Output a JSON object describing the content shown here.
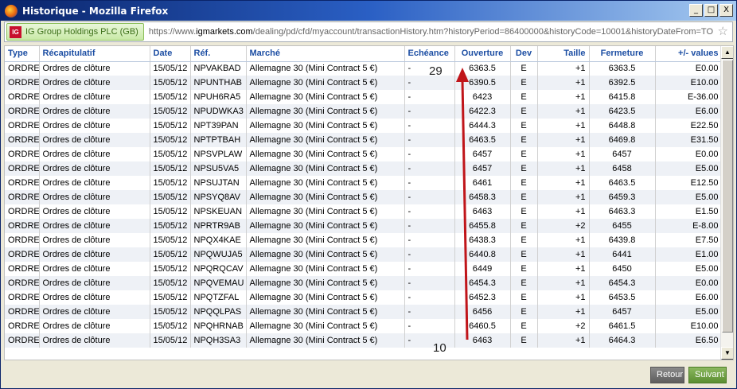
{
  "window": {
    "title": "Historique - Mozilla Firefox"
  },
  "controls": {
    "minimize": "_",
    "maximize": "□",
    "close": "X"
  },
  "urlbar": {
    "site_badge": "IG",
    "site_name": "IG Group Holdings PLC (GB)",
    "url_prefix": "https://www.",
    "url_domain": "igmarkets.com",
    "url_rest": "/dealing/pd/cfd/myaccount/transactionHistory.htm?historyPeriod=86400000&historyCode=10001&historyDateFrom=TO"
  },
  "table": {
    "headers": [
      "Type",
      "Récapitulatif",
      "Date",
      "Réf.",
      "Marché",
      "Echéance",
      "Ouverture",
      "Dev",
      "Taille",
      "Fermeture",
      "+/- values"
    ],
    "rows": [
      [
        "ORDRE",
        "Ordres de clôture",
        "15/05/12",
        "NPVAKBAD",
        "Allemagne 30 (Mini Contract 5 €)",
        "-",
        "6363.5",
        "E",
        "+1",
        "6363.5",
        "E0.00"
      ],
      [
        "ORDRE",
        "Ordres de clôture",
        "15/05/12",
        "NPUNTHAB",
        "Allemagne 30 (Mini Contract 5 €)",
        "-",
        "6390.5",
        "E",
        "+1",
        "6392.5",
        "E10.00"
      ],
      [
        "ORDRE",
        "Ordres de clôture",
        "15/05/12",
        "NPUH6RA5",
        "Allemagne 30 (Mini Contract 5 €)",
        "-",
        "6423",
        "E",
        "+1",
        "6415.8",
        "E-36.00"
      ],
      [
        "ORDRE",
        "Ordres de clôture",
        "15/05/12",
        "NPUDWKA3",
        "Allemagne 30 (Mini Contract 5 €)",
        "-",
        "6422.3",
        "E",
        "+1",
        "6423.5",
        "E6.00"
      ],
      [
        "ORDRE",
        "Ordres de clôture",
        "15/05/12",
        "NPT39PAN",
        "Allemagne 30 (Mini Contract 5 €)",
        "-",
        "6444.3",
        "E",
        "+1",
        "6448.8",
        "E22.50"
      ],
      [
        "ORDRE",
        "Ordres de clôture",
        "15/05/12",
        "NPTPTBAH",
        "Allemagne 30 (Mini Contract 5 €)",
        "-",
        "6463.5",
        "E",
        "+1",
        "6469.8",
        "E31.50"
      ],
      [
        "ORDRE",
        "Ordres de clôture",
        "15/05/12",
        "NPSVPLAW",
        "Allemagne 30 (Mini Contract 5 €)",
        "-",
        "6457",
        "E",
        "+1",
        "6457",
        "E0.00"
      ],
      [
        "ORDRE",
        "Ordres de clôture",
        "15/05/12",
        "NPSU5VA5",
        "Allemagne 30 (Mini Contract 5 €)",
        "-",
        "6457",
        "E",
        "+1",
        "6458",
        "E5.00"
      ],
      [
        "ORDRE",
        "Ordres de clôture",
        "15/05/12",
        "NPSUJTAN",
        "Allemagne 30 (Mini Contract 5 €)",
        "-",
        "6461",
        "E",
        "+1",
        "6463.5",
        "E12.50"
      ],
      [
        "ORDRE",
        "Ordres de clôture",
        "15/05/12",
        "NPSYQ8AV",
        "Allemagne 30 (Mini Contract 5 €)",
        "-",
        "6458.3",
        "E",
        "+1",
        "6459.3",
        "E5.00"
      ],
      [
        "ORDRE",
        "Ordres de clôture",
        "15/05/12",
        "NPSKEUAN",
        "Allemagne 30 (Mini Contract 5 €)",
        "-",
        "6463",
        "E",
        "+1",
        "6463.3",
        "E1.50"
      ],
      [
        "ORDRE",
        "Ordres de clôture",
        "15/05/12",
        "NPRTR9AB",
        "Allemagne 30 (Mini Contract 5 €)",
        "-",
        "6455.8",
        "E",
        "+2",
        "6455",
        "E-8.00"
      ],
      [
        "ORDRE",
        "Ordres de clôture",
        "15/05/12",
        "NPQX4KAE",
        "Allemagne 30 (Mini Contract 5 €)",
        "-",
        "6438.3",
        "E",
        "+1",
        "6439.8",
        "E7.50"
      ],
      [
        "ORDRE",
        "Ordres de clôture",
        "15/05/12",
        "NPQWUJA5",
        "Allemagne 30 (Mini Contract 5 €)",
        "-",
        "6440.8",
        "E",
        "+1",
        "6441",
        "E1.00"
      ],
      [
        "ORDRE",
        "Ordres de clôture",
        "15/05/12",
        "NPQRQCAV",
        "Allemagne 30 (Mini Contract 5 €)",
        "-",
        "6449",
        "E",
        "+1",
        "6450",
        "E5.00"
      ],
      [
        "ORDRE",
        "Ordres de clôture",
        "15/05/12",
        "NPQVEMAU",
        "Allemagne 30 (Mini Contract 5 €)",
        "-",
        "6454.3",
        "E",
        "+1",
        "6454.3",
        "E0.00"
      ],
      [
        "ORDRE",
        "Ordres de clôture",
        "15/05/12",
        "NPQTZFAL",
        "Allemagne 30 (Mini Contract 5 €)",
        "-",
        "6452.3",
        "E",
        "+1",
        "6453.5",
        "E6.00"
      ],
      [
        "ORDRE",
        "Ordres de clôture",
        "15/05/12",
        "NPQQLPAS",
        "Allemagne 30 (Mini Contract 5 €)",
        "-",
        "6456",
        "E",
        "+1",
        "6457",
        "E5.00"
      ],
      [
        "ORDRE",
        "Ordres de clôture",
        "15/05/12",
        "NPQHRNAB",
        "Allemagne 30 (Mini Contract 5 €)",
        "-",
        "6460.5",
        "E",
        "+2",
        "6461.5",
        "E10.00"
      ],
      [
        "ORDRE",
        "Ordres de clôture",
        "15/05/12",
        "NPQH3SA3",
        "Allemagne 30 (Mini Contract 5 €)",
        "-",
        "6463",
        "E",
        "+1",
        "6464.3",
        "E6.50"
      ]
    ]
  },
  "annotations": {
    "top_number": "29",
    "bottom_number": "10",
    "arrow_color": "#c0151a"
  },
  "buttons": {
    "back": "Retour",
    "next": "Suivant"
  }
}
